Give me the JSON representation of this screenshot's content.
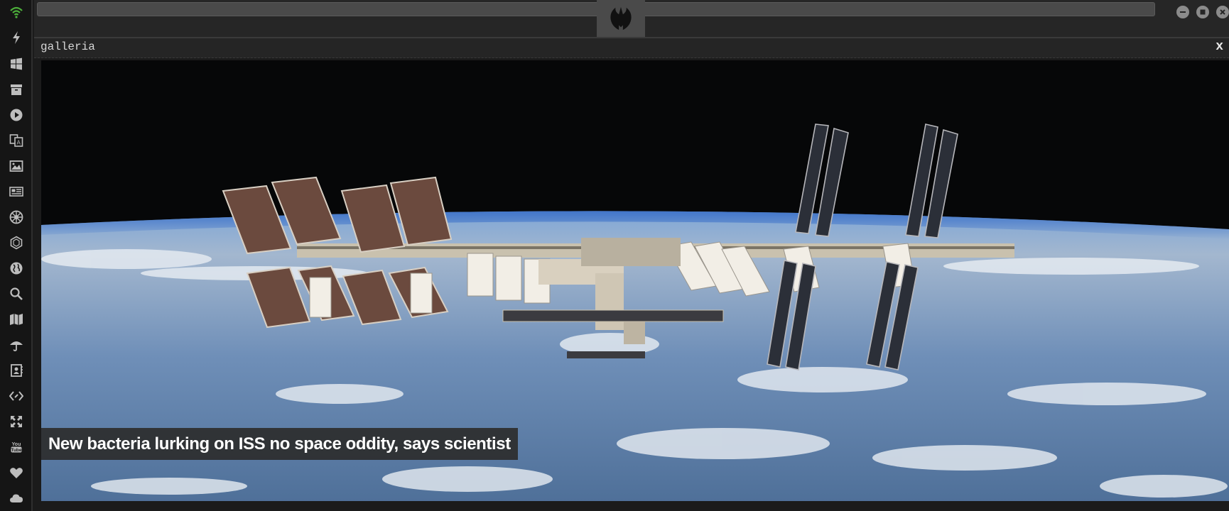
{
  "window": {
    "controls": [
      "minimize-icon",
      "maximize-icon",
      "close-icon"
    ],
    "logo_icon": "rebel-alliance-icon"
  },
  "sidebar": {
    "items": [
      {
        "icon": "wifi-icon"
      },
      {
        "icon": "lightning-icon"
      },
      {
        "icon": "windows-icon"
      },
      {
        "icon": "archive-icon"
      },
      {
        "icon": "play-icon"
      },
      {
        "icon": "translate-icon"
      },
      {
        "icon": "image-icon"
      },
      {
        "icon": "newspaper-icon"
      },
      {
        "icon": "galactic-empire-icon"
      },
      {
        "icon": "hexagon-icon"
      },
      {
        "icon": "globe-icon"
      },
      {
        "icon": "search-icon"
      },
      {
        "icon": "map-icon"
      },
      {
        "icon": "umbrella-icon"
      },
      {
        "icon": "contacts-icon"
      },
      {
        "icon": "code-icon"
      },
      {
        "icon": "expand-icon"
      },
      {
        "icon": "youtube-icon"
      },
      {
        "icon": "heart-icon"
      },
      {
        "icon": "cloud-icon"
      }
    ],
    "active_color": "#4caf3a"
  },
  "panel": {
    "title": "galleria",
    "close_label": "x"
  },
  "gallery": {
    "caption": "New bacteria lurking on ISS no space oddity, says scientist"
  }
}
